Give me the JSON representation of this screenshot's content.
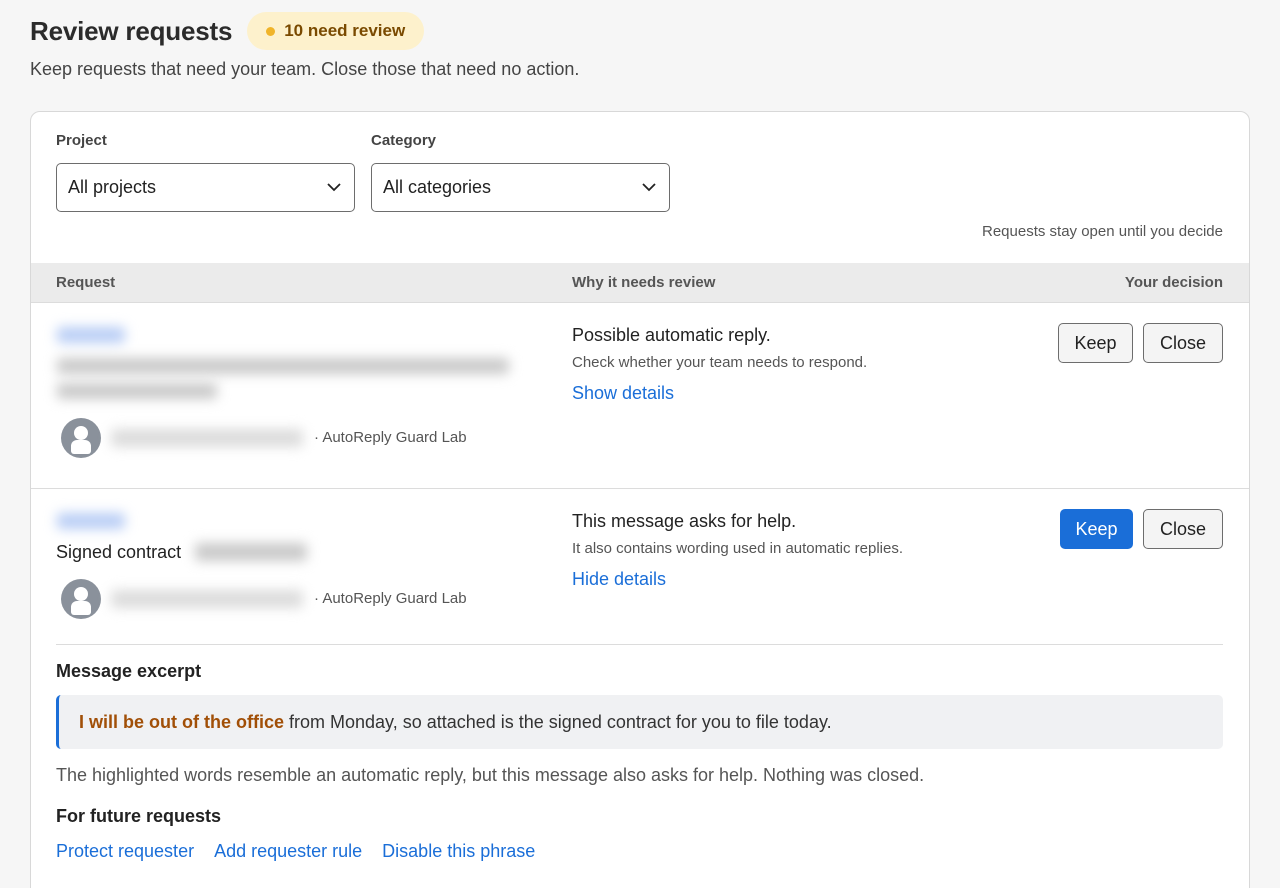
{
  "header": {
    "title": "Review requests",
    "badge": "10 need review",
    "subtitle": "Keep requests that need your team. Close those that need no action."
  },
  "filters": {
    "project": {
      "label": "Project",
      "value": "All projects"
    },
    "category": {
      "label": "Category",
      "value": "All categories"
    }
  },
  "note": "Requests stay open until you decide",
  "table": {
    "columns": [
      "Request",
      "Why it needs review",
      "Your decision"
    ]
  },
  "rows": [
    {
      "requester_org": "· AutoReply Guard Lab",
      "reason_title": "Possible automatic reply.",
      "reason_sub": "Check whether your team needs to respond.",
      "details_link": "Show details",
      "keep_label": "Keep",
      "close_label": "Close"
    },
    {
      "title": "Signed contract",
      "requester_org": "· AutoReply Guard Lab",
      "reason_title": "This message asks for help.",
      "reason_sub": "It also contains wording used in automatic replies.",
      "details_link": "Hide details",
      "keep_label": "Keep",
      "close_label": "Close",
      "excerpt_label": "Message excerpt",
      "excerpt_highlight": "I will be out of the office",
      "excerpt_rest": " from Monday, so attached is the signed contract for you to file today.",
      "explanation": "The highlighted words resemble an automatic reply, but this message also asks for help. Nothing was closed.",
      "future_label": "For future requests",
      "future_links": [
        "Protect requester",
        "Add requester rule",
        "Disable this phrase"
      ]
    }
  ],
  "colors": {
    "accent": "#1a6ed8",
    "badge_bg": "#fdf1cc",
    "badge_dot": "#f0b429",
    "highlight": "#a14f07"
  },
  "icons": [
    "chevron-down-icon",
    "user-avatar-icon"
  ]
}
